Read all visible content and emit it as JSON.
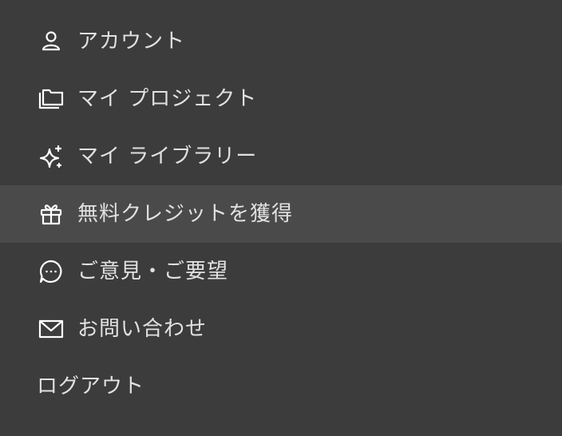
{
  "menu": {
    "items": [
      {
        "label": "アカウント",
        "icon": "user-icon"
      },
      {
        "label": "マイ プロジェクト",
        "icon": "folders-icon"
      },
      {
        "label": "マイ ライブラリー",
        "icon": "sparkles-icon"
      },
      {
        "label": "無料クレジットを獲得",
        "icon": "gift-icon"
      },
      {
        "label": "ご意見・ご要望",
        "icon": "chat-bubble-icon"
      },
      {
        "label": "お問い合わせ",
        "icon": "mail-icon"
      }
    ],
    "logout_label": "ログアウト",
    "colors": {
      "background": "#3c3c3c",
      "highlight": "#4a4a4a",
      "text": "#e1e1e1"
    }
  }
}
